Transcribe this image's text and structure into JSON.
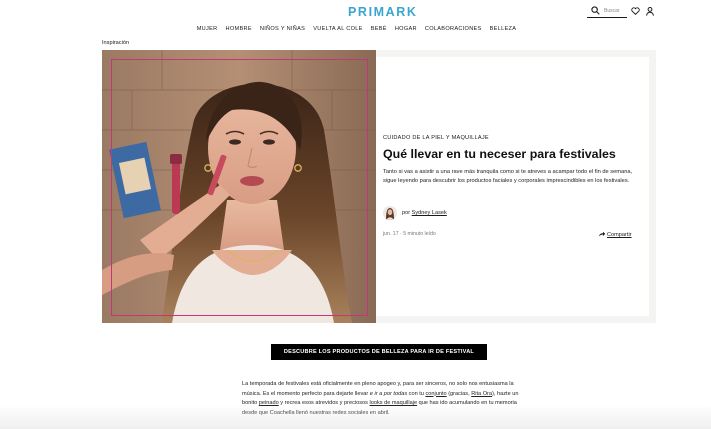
{
  "brand": {
    "logo": "PRIMARK",
    "accent": "#3aa6d0"
  },
  "search": {
    "placeholder": "Buscar"
  },
  "nav": {
    "items": [
      {
        "label": "MUJER"
      },
      {
        "label": "HOMBRE"
      },
      {
        "label": "NIÑOS Y NIÑAS"
      },
      {
        "label": "VUELTA AL COLE"
      },
      {
        "label": "BEBÉ"
      },
      {
        "label": "HOGAR"
      },
      {
        "label": "COLABORACIONES"
      },
      {
        "label": "BELLEZA"
      }
    ]
  },
  "breadcrumb": "Inspiración",
  "article": {
    "category": "CUIDADO DE LA PIEL Y MAQUILLAJE",
    "title": "Qué llevar en tu neceser para festivales",
    "lead": "Tanto si vas a asistir a una rave más tranquila como si te atreves a acampar todo el fin de semana, sigue leyendo para descubrir los productos faciales y corporales imprescindibles en los festivales.",
    "by_prefix": "por",
    "author": "Sydney Lasek",
    "date": "jun. 17",
    "separator": "·",
    "read_time": "5 minuto leído",
    "share_label": "Compartir",
    "frame_color": "#c1377a"
  },
  "cta": {
    "label": "DESCUBRE LOS PRODUCTOS DE BELLEZA PARA IR DE FESTIVAL"
  },
  "body": {
    "p1_a": "La temporada de festivales está oficialmente en pleno apogeo y, para ser sinceros, no solo nos entusiasma la música. Es el momento perfecto para dejarte llevar ",
    "p1_em": "e ir a por todas",
    "p1_b": " con tu ",
    "link_conjunto": "conjunto",
    "p1_c": " (gracias, ",
    "link_rita": "Rita Ora",
    "p1_d": "), hazte un bonito ",
    "link_peinado": "peinado",
    "p1_e": " y recrea esos atrevidos y preciosos ",
    "link_looks": "looks de maquillaje",
    "p1_f": " que has ido acumulando en tu memoria desde que Coachella llenó nuestras redes sociales en abril."
  }
}
